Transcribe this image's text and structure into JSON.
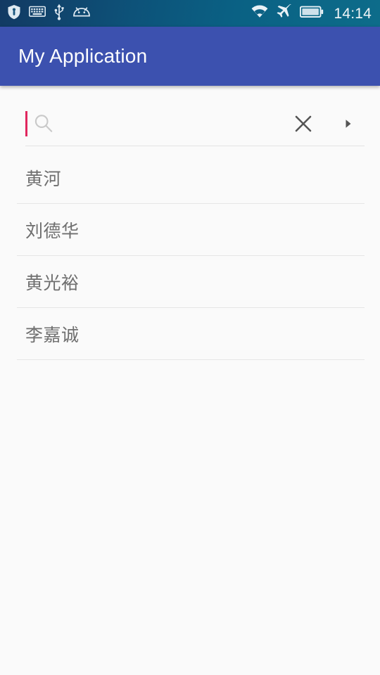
{
  "status_bar": {
    "left_icons": [
      {
        "name": "shield-alert-icon",
        "label": "shield"
      },
      {
        "name": "keyboard-icon",
        "label": "keyboard"
      },
      {
        "name": "usb-icon",
        "label": "usb"
      },
      {
        "name": "android-debug-icon",
        "label": "android"
      }
    ],
    "right_icons": [
      {
        "name": "wifi-icon",
        "label": "wifi"
      },
      {
        "name": "airplane-mode-icon",
        "label": "airplane mode"
      },
      {
        "name": "battery-icon",
        "label": "battery"
      }
    ],
    "time": "14:14",
    "background_start": "#123a63",
    "background_end": "#0d6c8a"
  },
  "app_bar": {
    "title": "My Application",
    "background": "#3c51af",
    "title_color": "#ffffff"
  },
  "search": {
    "value": "",
    "placeholder": "",
    "caret_color": "#e0275e",
    "search_icon": "search-icon",
    "clear_icon": "close-icon",
    "submit_icon": "play-arrow-icon",
    "underline_color": "#e3e3e3"
  },
  "suggestions": {
    "items": [
      {
        "label": "黄河"
      },
      {
        "label": "刘德华"
      },
      {
        "label": "黄光裕"
      },
      {
        "label": "李嘉诚"
      }
    ],
    "text_color": "#6f6f6f",
    "divider_color": "#e6e6e6"
  },
  "page": {
    "background": "#fafafa"
  }
}
